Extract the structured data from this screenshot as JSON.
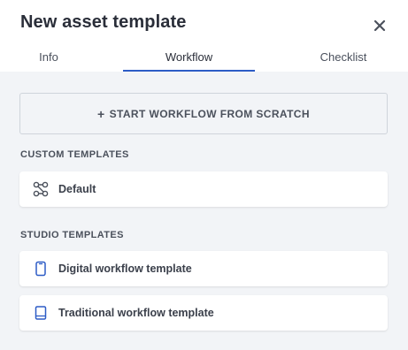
{
  "dialog": {
    "title": "New asset template"
  },
  "tabs": [
    {
      "label": "Info",
      "active": false
    },
    {
      "label": "Workflow",
      "active": true
    },
    {
      "label": "Checklist",
      "active": false
    }
  ],
  "actions": {
    "start_from_scratch": "START WORKFLOW FROM SCRATCH",
    "plus_glyph": "+"
  },
  "custom_templates": {
    "heading": "CUSTOM TEMPLATES",
    "items": [
      {
        "label": "Default",
        "icon": "workflow-nodes-icon"
      }
    ]
  },
  "studio_templates": {
    "heading": "STUDIO TEMPLATES",
    "items": [
      {
        "label": "Digital workflow template",
        "icon": "tablet-icon"
      },
      {
        "label": "Traditional workflow template",
        "icon": "sketchbook-icon"
      }
    ]
  },
  "colors": {
    "accent": "#2d5cc6",
    "background": "#f2f4f7",
    "card": "#ffffff",
    "text": "#2a2e39"
  }
}
